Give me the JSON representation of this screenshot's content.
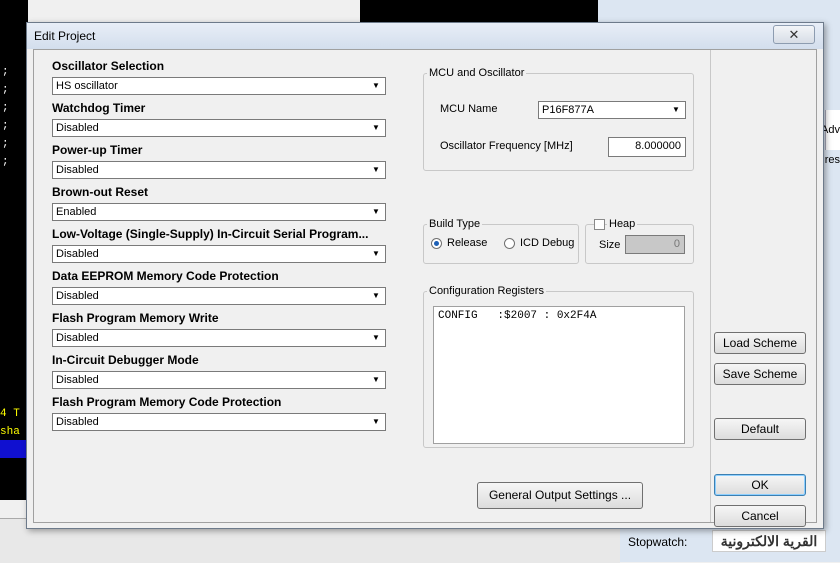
{
  "background": {
    "editor_semicolons": [
      ";",
      ";",
      ";",
      ";",
      ";",
      ";"
    ],
    "editor_lines": [
      "4 T",
      "sha"
    ],
    "right_side_labels": [
      "Adv",
      "res"
    ],
    "stopwatch_label": "Stopwatch:",
    "watermark_text": "القرية الالكترونية"
  },
  "dialog": {
    "title": "Edit Project",
    "close_glyph": "✕",
    "options": [
      {
        "label": "Oscillator Selection",
        "value": "HS oscillator"
      },
      {
        "label": "Watchdog Timer",
        "value": "Disabled"
      },
      {
        "label": "Power-up Timer",
        "value": "Disabled"
      },
      {
        "label": "Brown-out Reset",
        "value": "Enabled"
      },
      {
        "label": "Low-Voltage (Single-Supply) In-Circuit Serial Program...",
        "value": "Disabled"
      },
      {
        "label": "Data EEPROM Memory Code Protection",
        "value": "Disabled"
      },
      {
        "label": "Flash Program Memory Write",
        "value": "Disabled"
      },
      {
        "label": "In-Circuit Debugger Mode",
        "value": "Disabled"
      },
      {
        "label": "Flash Program Memory Code Protection",
        "value": "Disabled"
      }
    ],
    "mcu_group": {
      "title": "MCU and Oscillator",
      "mcu_name_label": "MCU Name",
      "mcu_name_value": "P16F877A",
      "freq_label": "Oscillator Frequency [MHz]",
      "freq_value": "8.000000"
    },
    "build_type": {
      "title": "Build Type",
      "release_label": "Release",
      "icd_label": "ICD Debug",
      "selected": "Release"
    },
    "heap": {
      "label": "Heap",
      "size_label": "Size",
      "size_value": "0",
      "checked": false
    },
    "config_registers": {
      "title": "Configuration Registers",
      "text": "CONFIG   :$2007 : 0x2F4A"
    },
    "buttons": {
      "general_output": "General Output Settings ...",
      "load_scheme": "Load Scheme",
      "save_scheme": "Save Scheme",
      "default": "Default",
      "ok": "OK",
      "cancel": "Cancel"
    }
  }
}
